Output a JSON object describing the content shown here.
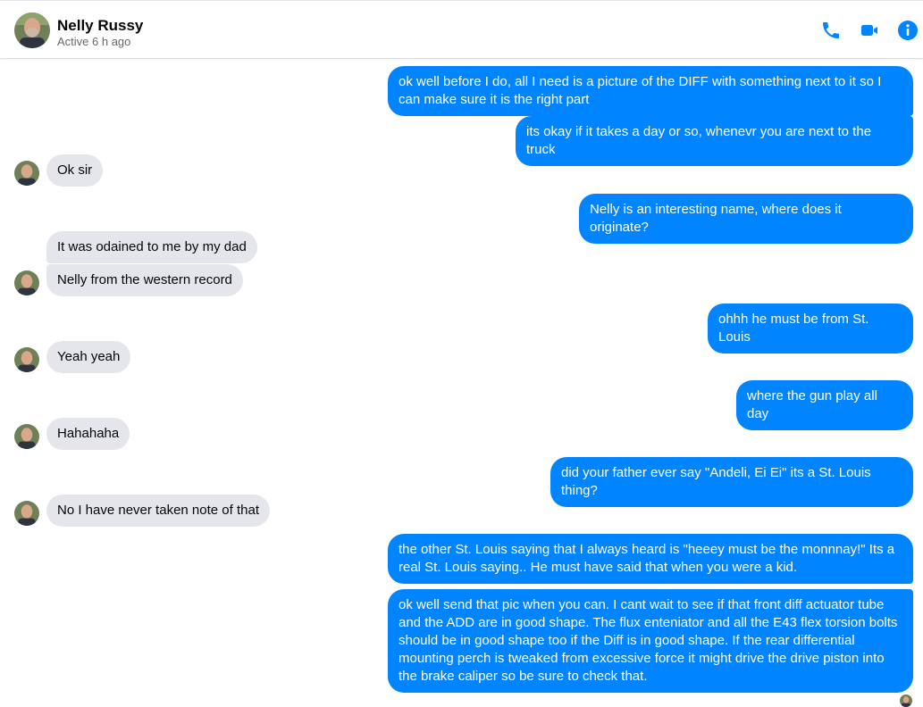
{
  "header": {
    "contact_name": "Nelly Russy",
    "status": "Active 6 h ago",
    "icons": [
      "phone-icon",
      "video-camera-icon",
      "info-icon"
    ]
  },
  "colors": {
    "accent": "#0084ff",
    "incoming_bubble": "#e4e6eb",
    "outgoing_text": "#ffffff",
    "incoming_text": "#050505",
    "status_text": "#65676b"
  },
  "messages": [
    {
      "from": "me",
      "text": "ok well before I do, all I need is a picture of the DIFF with something next to it so I can make sure it is the right part"
    },
    {
      "from": "me",
      "text": "its okay if it takes a day or so, whenevr you are next to the truck"
    },
    {
      "from": "contact",
      "text": "Ok sir"
    },
    {
      "from": "me",
      "text": "Nelly is an interesting name, where does it originate?"
    },
    {
      "from": "contact",
      "text": "It was odained to me by my dad"
    },
    {
      "from": "contact",
      "text": "Nelly from the western record"
    },
    {
      "from": "me",
      "text": "ohhh he must be from St. Louis"
    },
    {
      "from": "contact",
      "text": "Yeah yeah"
    },
    {
      "from": "me",
      "text": "where the gun play all day"
    },
    {
      "from": "contact",
      "text": "Hahahaha"
    },
    {
      "from": "me",
      "text": "did your father ever say \"Andeli, Ei Ei\" its a St. Louis thing?"
    },
    {
      "from": "contact",
      "text": "No I have never taken note of that"
    },
    {
      "from": "me",
      "text": "the other St. Louis saying that I always heard is \"heeey must be the monnnay!\" Its a real St. Louis saying.. He must have said that when you were a kid."
    },
    {
      "from": "me",
      "text": "ok well send that pic when you can. I cant wait to see if that front diff actuator tube and the ADD are in good shape. The flux enteniator and all the E43 flex torsion bolts should be in good shape too if the Diff is in good shape. If the rear differential mounting perch is tweaked from excessive force it might drive the drive piston into the brake caliper so be sure to check that."
    }
  ]
}
